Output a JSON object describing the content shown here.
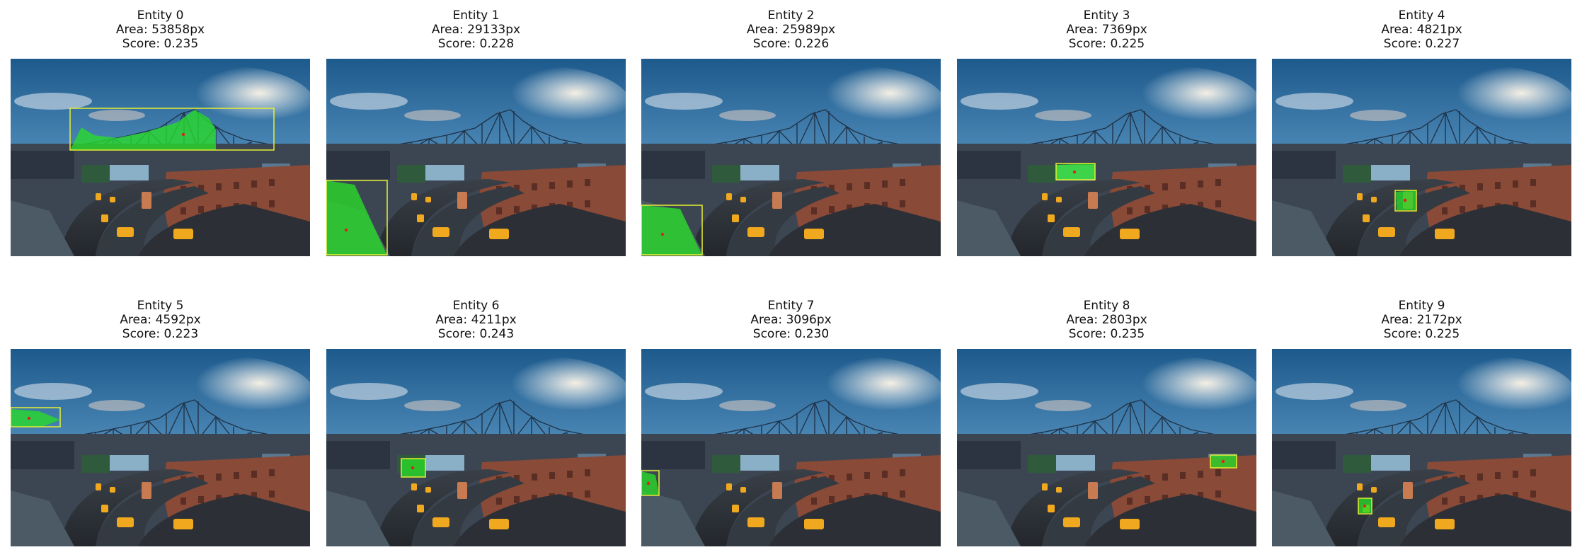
{
  "entities": [
    {
      "title": "Entity 0",
      "area": "Area: 53858px",
      "score": "Score: 0.235"
    },
    {
      "title": "Entity 1",
      "area": "Area: 29133px",
      "score": "Score: 0.228"
    },
    {
      "title": "Entity 2",
      "area": "Area: 25989px",
      "score": "Score: 0.226"
    },
    {
      "title": "Entity 3",
      "area": "Area: 7369px",
      "score": "Score: 0.225"
    },
    {
      "title": "Entity 4",
      "area": "Area: 4821px",
      "score": "Score: 0.227"
    },
    {
      "title": "Entity 5",
      "area": "Area: 4592px",
      "score": "Score: 0.223"
    },
    {
      "title": "Entity 6",
      "area": "Area: 4211px",
      "score": "Score: 0.243"
    },
    {
      "title": "Entity 7",
      "area": "Area: 3096px",
      "score": "Score: 0.230"
    },
    {
      "title": "Entity 8",
      "area": "Area: 2803px",
      "score": "Score: 0.235"
    },
    {
      "title": "Entity 9",
      "area": "Area: 2172px",
      "score": "Score: 0.225"
    }
  ],
  "colors": {
    "mask": "#28dc28",
    "box": "#e8f030",
    "point": "#e02020"
  }
}
